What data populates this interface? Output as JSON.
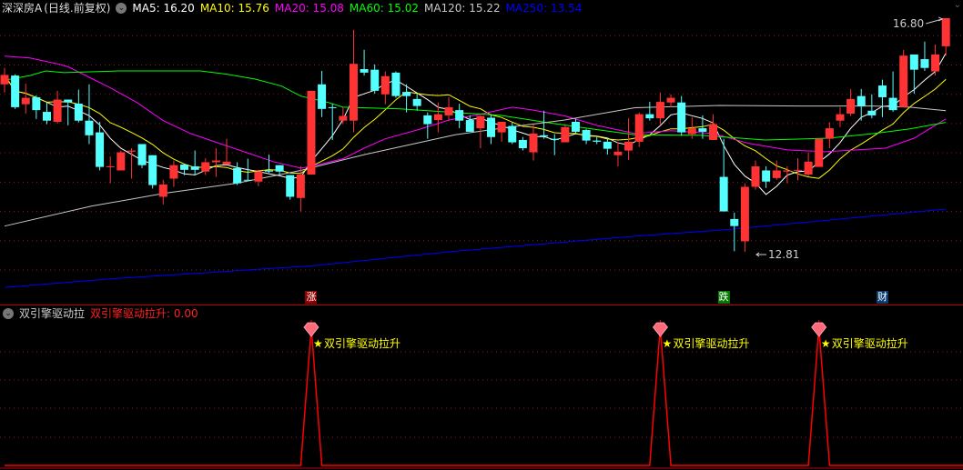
{
  "header": {
    "title": "深深房A",
    "period": "(日线.前复权)",
    "ma_labels": [
      {
        "label": "MA5: 16.20",
        "color": "#ffffff"
      },
      {
        "label": "MA10: 15.76",
        "color": "#ffff00"
      },
      {
        "label": "MA20: 15.08",
        "color": "#ff00ff"
      },
      {
        "label": "MA60: 15.02",
        "color": "#00ff00"
      },
      {
        "label": "MA120: 15.22",
        "color": "#c8c8c8"
      },
      {
        "label": "MA250: 13.54",
        "color": "#0000ff"
      }
    ]
  },
  "markers": [
    {
      "index": 29,
      "label": "涨",
      "color": "#8b0000"
    },
    {
      "index": 68,
      "label": "跌",
      "color": "#007a00"
    },
    {
      "index": 83,
      "label": "财",
      "color": "#0a3a6e"
    }
  ],
  "sub_header": {
    "name": "双引擎驱动拉",
    "value_label": "双引擎驱动拉升: 0.00"
  },
  "colors": {
    "up": "#ff3333",
    "down": "#54ffff",
    "grid": "#8a1a1a",
    "signal": "#ff0000",
    "signal_text": "#ffff00"
  },
  "chart_data": [
    {
      "type": "candlestick",
      "ylim": [
        11.91,
        17.11
      ],
      "gridlines": [
        12.5,
        13.0,
        13.5,
        14.0,
        14.5,
        15.0,
        15.5,
        16.0,
        16.5
      ],
      "high_label": "16.80",
      "low_label": "12.81",
      "high_index": 89,
      "low_index": 70,
      "candles_ohlc": [
        [
          15.67,
          15.95,
          15.53,
          15.83
        ],
        [
          15.82,
          15.84,
          15.25,
          15.28
        ],
        [
          15.33,
          15.68,
          15.17,
          15.44
        ],
        [
          15.45,
          15.48,
          15.08,
          15.23
        ],
        [
          15.2,
          15.36,
          14.99,
          15.05
        ],
        [
          15.03,
          15.56,
          15.0,
          15.41
        ],
        [
          15.41,
          15.41,
          14.97,
          15.36
        ],
        [
          15.34,
          15.58,
          15.02,
          15.05
        ],
        [
          15.05,
          15.67,
          14.65,
          14.8
        ],
        [
          14.85,
          15.03,
          14.2,
          14.26
        ],
        [
          14.26,
          14.44,
          13.98,
          14.27
        ],
        [
          14.2,
          14.54,
          14.2,
          14.51
        ],
        [
          14.52,
          14.58,
          14.06,
          14.54
        ],
        [
          14.65,
          14.65,
          14.24,
          14.29
        ],
        [
          14.46,
          14.46,
          13.89,
          13.95
        ],
        [
          13.75,
          14.04,
          13.62,
          13.96
        ],
        [
          14.06,
          14.37,
          13.92,
          14.29
        ],
        [
          14.3,
          14.3,
          14.12,
          14.21
        ],
        [
          14.27,
          14.54,
          14.13,
          14.21
        ],
        [
          14.18,
          14.41,
          14.12,
          14.34
        ],
        [
          14.34,
          14.58,
          14.09,
          14.37
        ],
        [
          14.3,
          14.74,
          14.3,
          14.35
        ],
        [
          14.24,
          14.34,
          13.95,
          13.98
        ],
        [
          14.04,
          14.4,
          14.03,
          14.03
        ],
        [
          14.01,
          14.21,
          13.93,
          14.18
        ],
        [
          14.2,
          14.47,
          14.16,
          14.18
        ],
        [
          14.29,
          14.29,
          14.13,
          14.18
        ],
        [
          14.12,
          14.12,
          13.7,
          13.75
        ],
        [
          13.73,
          14.27,
          13.5,
          14.13
        ],
        [
          14.13,
          15.56,
          14.13,
          15.56
        ],
        [
          15.67,
          15.9,
          15.11,
          15.25
        ],
        [
          15.28,
          15.34,
          14.72,
          15.27
        ],
        [
          15.05,
          15.27,
          14.99,
          15.13
        ],
        [
          15.05,
          16.6,
          14.85,
          16.02
        ],
        [
          15.93,
          16.26,
          15.82,
          15.87
        ],
        [
          15.92,
          16.01,
          15.51,
          15.56
        ],
        [
          15.5,
          15.89,
          15.33,
          15.81
        ],
        [
          15.87,
          15.89,
          15.44,
          15.47
        ],
        [
          15.54,
          15.67,
          15.19,
          15.47
        ],
        [
          15.42,
          15.51,
          15.22,
          15.3
        ],
        [
          15.14,
          15.19,
          14.74,
          14.99
        ],
        [
          15.06,
          15.36,
          14.85,
          15.16
        ],
        [
          15.14,
          15.45,
          15.05,
          15.28
        ],
        [
          15.23,
          15.34,
          14.92,
          15.05
        ],
        [
          15.06,
          15.14,
          14.86,
          14.86
        ],
        [
          14.92,
          15.14,
          14.58,
          15.13
        ],
        [
          15.1,
          15.16,
          14.65,
          14.77
        ],
        [
          14.85,
          15.03,
          14.69,
          15.03
        ],
        [
          14.96,
          15.02,
          14.65,
          14.68
        ],
        [
          14.72,
          14.77,
          14.54,
          14.58
        ],
        [
          14.51,
          14.99,
          14.37,
          14.83
        ],
        [
          14.8,
          15.22,
          14.74,
          14.78
        ],
        [
          14.74,
          14.82,
          14.46,
          14.72
        ],
        [
          14.68,
          14.97,
          14.68,
          14.94
        ],
        [
          15.03,
          15.08,
          14.83,
          14.86
        ],
        [
          14.89,
          14.91,
          14.65,
          14.71
        ],
        [
          14.71,
          14.77,
          14.65,
          14.69
        ],
        [
          14.69,
          14.74,
          14.47,
          14.57
        ],
        [
          14.46,
          14.68,
          14.27,
          14.52
        ],
        [
          14.54,
          15.09,
          14.38,
          14.69
        ],
        [
          14.69,
          15.19,
          14.6,
          15.16
        ],
        [
          15.16,
          15.37,
          15.05,
          15.09
        ],
        [
          15.09,
          15.53,
          14.97,
          15.37
        ],
        [
          15.36,
          15.5,
          15.28,
          15.44
        ],
        [
          15.36,
          15.47,
          14.79,
          14.85
        ],
        [
          14.82,
          15.11,
          14.74,
          14.92
        ],
        [
          14.92,
          15.14,
          14.74,
          14.86
        ],
        [
          14.72,
          15.16,
          14.72,
          14.99
        ],
        [
          14.09,
          14.74,
          13.5,
          13.5
        ],
        [
          13.37,
          13.48,
          12.82,
          13.25
        ],
        [
          12.99,
          13.98,
          12.81,
          13.92
        ],
        [
          13.92,
          14.37,
          13.87,
          14.27
        ],
        [
          14.2,
          14.27,
          13.9,
          14.01
        ],
        [
          14.07,
          14.37,
          14.04,
          14.2
        ],
        [
          14.18,
          14.27,
          13.98,
          14.2
        ],
        [
          14.2,
          14.41,
          14.03,
          14.21
        ],
        [
          14.13,
          14.51,
          14.1,
          14.35
        ],
        [
          14.26,
          14.74,
          14.26,
          14.74
        ],
        [
          14.74,
          15.02,
          14.58,
          14.92
        ],
        [
          15.05,
          15.28,
          14.94,
          15.16
        ],
        [
          15.17,
          15.59,
          15.13,
          15.42
        ],
        [
          15.47,
          15.59,
          15.05,
          15.3
        ],
        [
          15.22,
          15.5,
          15.09,
          15.14
        ],
        [
          15.65,
          15.75,
          15.11,
          15.45
        ],
        [
          15.44,
          15.89,
          15.2,
          15.23
        ],
        [
          15.28,
          16.26,
          15.28,
          16.16
        ],
        [
          16.18,
          16.18,
          15.51,
          15.92
        ],
        [
          16.1,
          16.4,
          15.9,
          15.95
        ],
        [
          15.89,
          16.35,
          15.82,
          16.18
        ],
        [
          16.32,
          16.8,
          16.16,
          16.8
        ]
      ],
      "moving_averages": [
        {
          "name": "MA5",
          "period": 5,
          "color": "#ffffff"
        },
        {
          "name": "MA10",
          "period": 10,
          "color": "#ffff00"
        },
        {
          "name": "MA20",
          "color": "#ff00ff",
          "points": [
            [
              0,
              16.15
            ],
            [
              2.4,
              16.12
            ],
            [
              5,
              16.02
            ],
            [
              6,
              15.97
            ],
            [
              8,
              15.79
            ],
            [
              10,
              15.61
            ],
            [
              12.5,
              15.36
            ],
            [
              15,
              15.05
            ],
            [
              17.6,
              14.83
            ],
            [
              20,
              14.68
            ],
            [
              22.8,
              14.51
            ],
            [
              25.4,
              14.35
            ],
            [
              28,
              14.24
            ],
            [
              29,
              14.27
            ],
            [
              32,
              14.4
            ],
            [
              34,
              14.58
            ],
            [
              36,
              14.74
            ],
            [
              39,
              14.89
            ],
            [
              42,
              15.06
            ],
            [
              45,
              15.16
            ],
            [
              48,
              15.28
            ],
            [
              50,
              15.23
            ],
            [
              53,
              15.13
            ],
            [
              56,
              14.97
            ],
            [
              59.6,
              14.83
            ],
            [
              63,
              14.88
            ],
            [
              67,
              14.83
            ],
            [
              70.4,
              14.66
            ],
            [
              74,
              14.55
            ],
            [
              77.6,
              14.52
            ],
            [
              83.3,
              14.58
            ],
            [
              86,
              14.75
            ],
            [
              89,
              15.08
            ]
          ]
        },
        {
          "name": "MA60",
          "color": "#00ff00",
          "points": [
            [
              0,
              15.74
            ],
            [
              2.4,
              15.82
            ],
            [
              3.9,
              15.9
            ],
            [
              5.6,
              15.87
            ],
            [
              10.8,
              15.9
            ],
            [
              18.5,
              15.9
            ],
            [
              21.1,
              15.84
            ],
            [
              23.7,
              15.76
            ],
            [
              26.2,
              15.64
            ],
            [
              28,
              15.47
            ],
            [
              30.6,
              15.36
            ],
            [
              32,
              15.28
            ],
            [
              37.4,
              15.25
            ],
            [
              42.6,
              15.19
            ],
            [
              46.9,
              15.14
            ],
            [
              51.2,
              15.02
            ],
            [
              55.5,
              14.91
            ],
            [
              59.6,
              14.81
            ],
            [
              65.8,
              14.8
            ],
            [
              71.9,
              14.72
            ],
            [
              77.9,
              14.75
            ],
            [
              82.2,
              14.83
            ],
            [
              85.6,
              14.91
            ],
            [
              89,
              15.02
            ]
          ]
        },
        {
          "name": "MA120",
          "color": "#c8c8c8",
          "points": [
            [
              0,
              13.25
            ],
            [
              8.2,
              13.59
            ],
            [
              15.1,
              13.81
            ],
            [
              21.9,
              13.98
            ],
            [
              28,
              14.2
            ],
            [
              34,
              14.47
            ],
            [
              42.6,
              14.81
            ],
            [
              47.8,
              14.94
            ],
            [
              52.9,
              15.06
            ],
            [
              59.6,
              15.27
            ],
            [
              61.5,
              15.28
            ],
            [
              67.6,
              15.31
            ],
            [
              75.3,
              15.3
            ],
            [
              82.2,
              15.3
            ],
            [
              85.6,
              15.28
            ],
            [
              89,
              15.22
            ]
          ]
        },
        {
          "name": "MA250",
          "color": "#0000ff",
          "points": [
            [
              0,
              12.2
            ],
            [
              10,
              12.35
            ],
            [
              29,
              12.57
            ],
            [
              42.6,
              12.82
            ],
            [
              59.8,
              13.08
            ],
            [
              68.4,
              13.19
            ],
            [
              89,
              13.54
            ]
          ]
        }
      ]
    },
    {
      "type": "line",
      "name": "双引擎驱动拉升",
      "signal_label": "双引擎驱动拉升",
      "signal_star": "★",
      "ylim": [
        0,
        1
      ],
      "values": [
        0,
        0,
        0,
        0,
        0,
        0,
        0,
        0,
        0,
        0,
        0,
        0,
        0,
        0,
        0,
        0,
        0,
        0,
        0,
        0,
        0,
        0,
        0,
        0,
        0,
        0,
        0,
        0,
        0,
        1,
        0,
        0,
        0,
        0,
        0,
        0,
        0,
        0,
        0,
        0,
        0,
        0,
        0,
        0,
        0,
        0,
        0,
        0,
        0,
        0,
        0,
        0,
        0,
        0,
        0,
        0,
        0,
        0,
        0,
        0,
        0,
        0,
        1,
        0,
        0,
        0,
        0,
        0,
        0,
        0,
        0,
        0,
        0,
        0,
        0,
        0,
        0,
        1,
        0,
        0,
        0,
        0,
        0,
        0,
        0,
        0,
        0,
        0,
        0,
        0
      ]
    }
  ]
}
